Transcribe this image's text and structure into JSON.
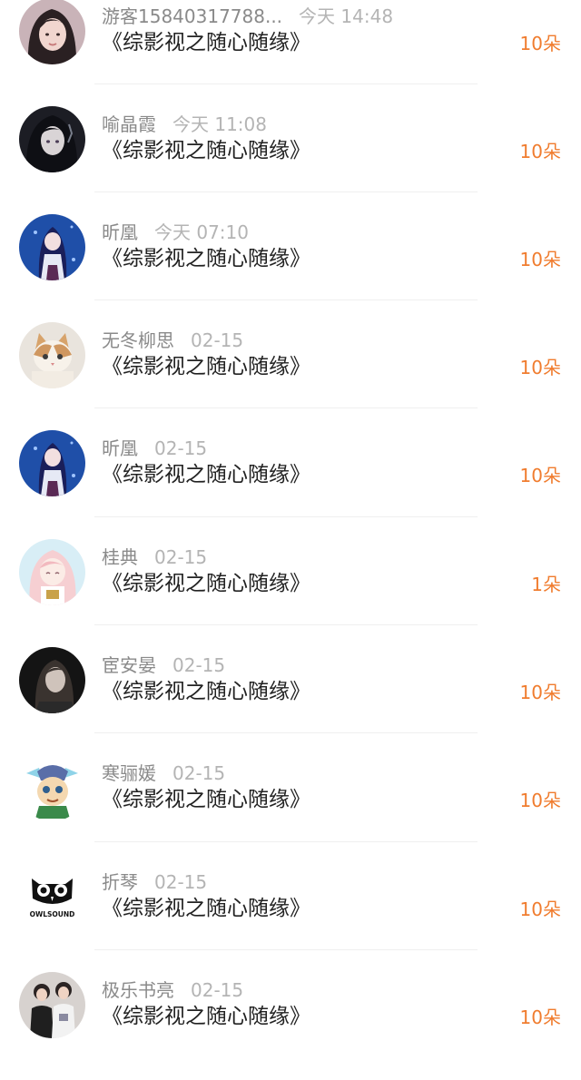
{
  "items": [
    {
      "user": "游客15840317788...",
      "time": "今天 14:48",
      "title": "《综影视之随心随缘》",
      "gift": "10朵",
      "avatar_icon": "avatar-woman-dark-hair-icon"
    },
    {
      "user": "喻晶霞",
      "time": "今天 11:08",
      "title": "《综影视之随心随缘》",
      "gift": "10朵",
      "avatar_icon": "avatar-dark-anime-girl-icon"
    },
    {
      "user": "昕凰",
      "time": "今天 07:10",
      "title": "《综影视之随心随缘》",
      "gift": "10朵",
      "avatar_icon": "avatar-blue-anime-girl-icon"
    },
    {
      "user": "无冬柳思",
      "time": "02-15",
      "title": "《综影视之随心随缘》",
      "gift": "10朵",
      "avatar_icon": "avatar-cat-icon"
    },
    {
      "user": "昕凰",
      "time": "02-15",
      "title": "《综影视之随心随缘》",
      "gift": "10朵",
      "avatar_icon": "avatar-blue-anime-girl-icon"
    },
    {
      "user": "桂典",
      "time": "02-15",
      "title": "《综影视之随心随缘》",
      "gift": "1朵",
      "avatar_icon": "avatar-pink-anime-girl-icon"
    },
    {
      "user": "宦安晏",
      "time": "02-15",
      "title": "《综影视之随心随缘》",
      "gift": "10朵",
      "avatar_icon": "avatar-dark-portrait-icon"
    },
    {
      "user": "寒骊媛",
      "time": "02-15",
      "title": "《综影视之随心随缘》",
      "gift": "10朵",
      "avatar_icon": "avatar-game-character-icon"
    },
    {
      "user": "折琴",
      "time": "02-15",
      "title": "《综影视之随心随缘》",
      "gift": "10朵",
      "avatar_icon": "avatar-owlsound-logo-icon",
      "avatar_logo_text": "OWLSOUND"
    },
    {
      "user": "极乐书亮",
      "time": "02-15",
      "title": "《综影视之随心随缘》",
      "gift": "10朵",
      "avatar_icon": "avatar-two-people-icon"
    }
  ],
  "colors": {
    "username": "#8a8a8a",
    "time": "#b4b4b4",
    "title": "#222222",
    "gift": "#f07c2e",
    "divider": "#efefef"
  }
}
